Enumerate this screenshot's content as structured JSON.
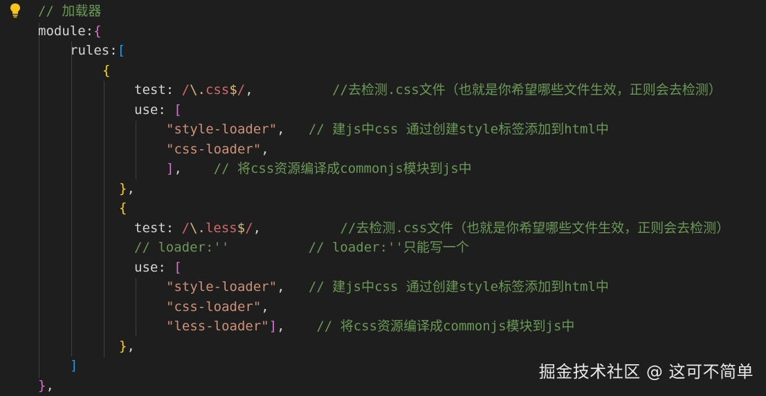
{
  "editor": {
    "lines": [
      [
        {
          "t": "// 加载器",
          "c": "c-cm"
        }
      ],
      [
        {
          "t": "module:",
          "c": "c-kw"
        },
        {
          "t": "{",
          "c": "c-b2"
        }
      ],
      [
        {
          "t": "rules:",
          "c": "c-kw"
        },
        {
          "t": "[",
          "c": "c-b3"
        }
      ],
      [
        {
          "t": "{",
          "c": "c-b1"
        }
      ],
      [
        {
          "t": "test: ",
          "c": "c-kw"
        },
        {
          "t": "/",
          "c": "c-rx"
        },
        {
          "t": "\\.",
          "c": "c-rxe"
        },
        {
          "t": "css",
          "c": "c-rx"
        },
        {
          "t": "$",
          "c": "c-rxe"
        },
        {
          "t": "/",
          "c": "c-rx"
        },
        {
          "t": ",          ",
          "c": "c-pun"
        },
        {
          "t": "//去检测.css文件（也就是你希望哪些文件生效，正则会去检测）",
          "c": "c-cm"
        }
      ],
      [
        {
          "t": "use: ",
          "c": "c-kw"
        },
        {
          "t": "[",
          "c": "c-b2"
        }
      ],
      [
        {
          "t": "\"style-loader\"",
          "c": "c-str"
        },
        {
          "t": ",   ",
          "c": "c-pun"
        },
        {
          "t": "// 建js中css 通过创建style标签添加到html中",
          "c": "c-cm"
        }
      ],
      [
        {
          "t": "\"css-loader\"",
          "c": "c-str"
        },
        {
          "t": ",",
          "c": "c-pun"
        }
      ],
      [
        {
          "t": "]",
          "c": "c-b2"
        },
        {
          "t": ",    ",
          "c": "c-pun"
        },
        {
          "t": "// 将css资源编译成commonjs模块到js中",
          "c": "c-cm"
        }
      ],
      [
        {
          "t": "}",
          "c": "c-b1"
        },
        {
          "t": ",",
          "c": "c-pun"
        }
      ],
      [
        {
          "t": "{",
          "c": "c-b1"
        }
      ],
      [
        {
          "t": "test: ",
          "c": "c-kw"
        },
        {
          "t": "/",
          "c": "c-rx"
        },
        {
          "t": "\\.",
          "c": "c-rxe"
        },
        {
          "t": "less",
          "c": "c-rx"
        },
        {
          "t": "$",
          "c": "c-rxe"
        },
        {
          "t": "/",
          "c": "c-rx"
        },
        {
          "t": ",          ",
          "c": "c-pun"
        },
        {
          "t": "//去检测.css文件（也就是你希望哪些文件生效，正则会去检测）",
          "c": "c-cm"
        }
      ],
      [
        {
          "t": "// loader:''          // loader:''只能写一个",
          "c": "c-cm"
        }
      ],
      [
        {
          "t": "use: ",
          "c": "c-kw"
        },
        {
          "t": "[",
          "c": "c-b2"
        }
      ],
      [
        {
          "t": "\"style-loader\"",
          "c": "c-str"
        },
        {
          "t": ",   ",
          "c": "c-pun"
        },
        {
          "t": "// 建js中css 通过创建style标签添加到html中",
          "c": "c-cm"
        }
      ],
      [
        {
          "t": "\"css-loader\"",
          "c": "c-str"
        },
        {
          "t": ",",
          "c": "c-pun"
        }
      ],
      [
        {
          "t": "\"less-loader\"",
          "c": "c-str"
        },
        {
          "t": "]",
          "c": "c-b2"
        },
        {
          "t": ",    ",
          "c": "c-pun"
        },
        {
          "t": "// 将css资源编译成commonjs模块到js中",
          "c": "c-cm"
        }
      ],
      [
        {
          "t": "}",
          "c": "c-b1"
        },
        {
          "t": ",",
          "c": "c-pun"
        }
      ],
      [
        {
          "t": "]",
          "c": "c-b3"
        }
      ],
      [
        {
          "t": "}",
          "c": "c-b2"
        },
        {
          "t": ",",
          "c": "c-pun"
        }
      ]
    ]
  },
  "watermark": {
    "text": "掘金技术社区 @ 这可不简单"
  },
  "icons": {
    "lightbulb": "lightbulb-icon"
  },
  "colors": {
    "background": "#1e1e1e",
    "comment": "#6a9955",
    "string": "#ce9178",
    "regex": "#d16969",
    "bracket_gold": "#ffd700",
    "bracket_purple": "#da70d6",
    "bracket_blue": "#179fff"
  }
}
